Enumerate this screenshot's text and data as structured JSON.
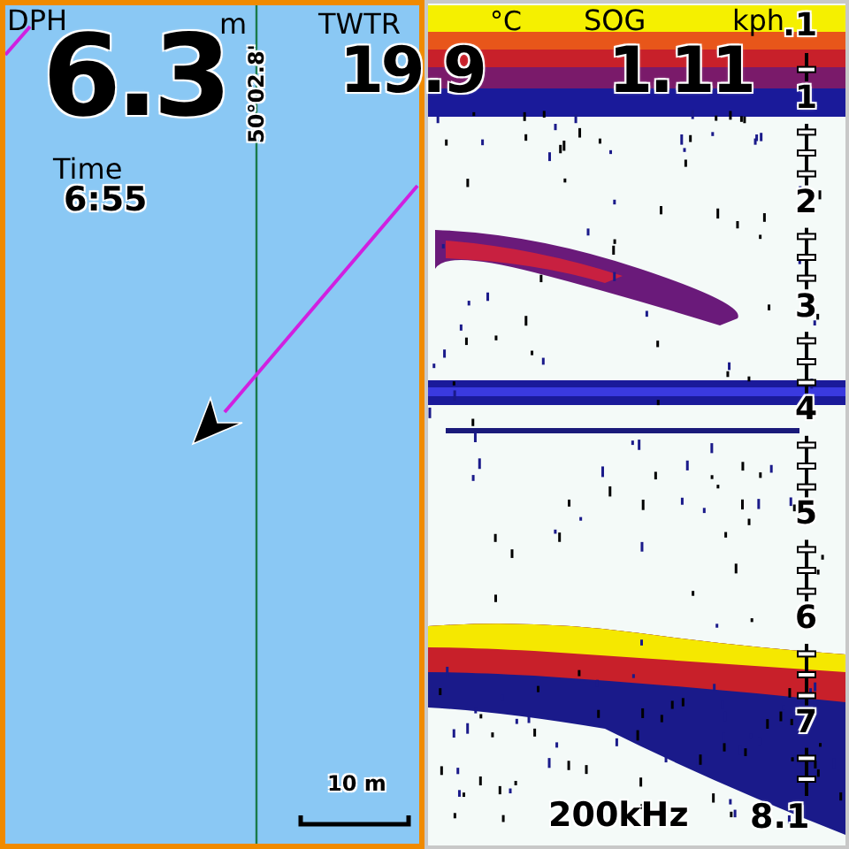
{
  "depth": {
    "label": "DPH",
    "value": "6.3",
    "unit": "m"
  },
  "latitude": "50°02.8'",
  "time": {
    "label": "Time",
    "value": "6:55"
  },
  "water_temp": {
    "label": "TWTR",
    "value": "19.9",
    "unit": "°C"
  },
  "speed": {
    "label": "SOG",
    "value": "1.11",
    "unit": "kph"
  },
  "map_scale": "10 m",
  "sonar": {
    "frequency": "200kHz",
    "depth_scale": [
      ".1",
      "1",
      "2",
      "3",
      "4",
      "5",
      "6",
      "7"
    ],
    "bottom_depth": "8.1"
  }
}
